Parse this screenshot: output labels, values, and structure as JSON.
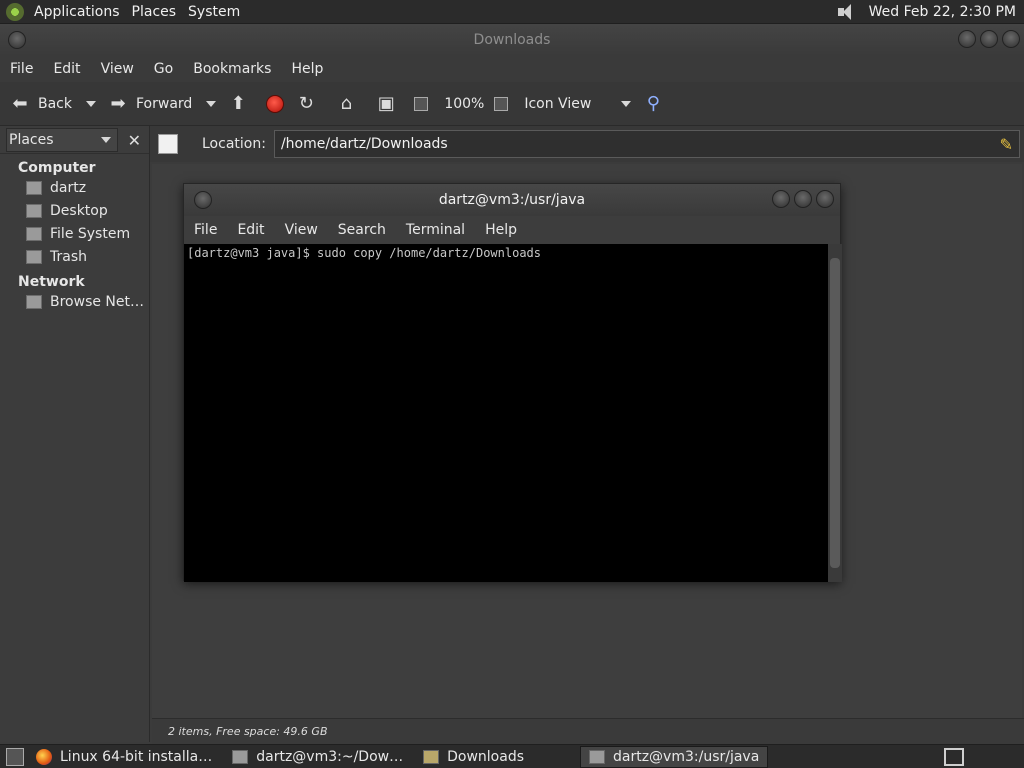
{
  "top_panel": {
    "menus": [
      "Applications",
      "Places",
      "System"
    ],
    "clock": "Wed Feb 22, 2:30 PM"
  },
  "file_manager": {
    "title": "Downloads",
    "menus": [
      "File",
      "Edit",
      "View",
      "Go",
      "Bookmarks",
      "Help"
    ],
    "toolbar": {
      "back": "Back",
      "forward": "Forward",
      "zoom": "100%",
      "view_mode": "Icon View"
    },
    "side_pane": {
      "selector": "Places",
      "sections": [
        {
          "title": "Computer",
          "items": [
            "dartz",
            "Desktop",
            "File System",
            "Trash"
          ]
        },
        {
          "title": "Network",
          "items": [
            "Browse Net…"
          ]
        }
      ]
    },
    "location": {
      "label": "Location:",
      "value": "/home/dartz/Downloads"
    },
    "status": "2 items, Free space: 49.6 GB"
  },
  "terminal": {
    "title": "dartz@vm3:/usr/java",
    "menus": [
      "File",
      "Edit",
      "View",
      "Search",
      "Terminal",
      "Help"
    ],
    "output": "[dartz@vm3 java]$ sudo copy /home/dartz/Downloads"
  },
  "taskbar": {
    "tasks": [
      {
        "label": "Linux 64-bit installa…",
        "icon": "firefox-icon"
      },
      {
        "label": "dartz@vm3:~/Dow…",
        "icon": "terminal-icon"
      },
      {
        "label": "Downloads",
        "icon": "folder-icon"
      },
      {
        "label": "dartz@vm3:/usr/java",
        "icon": "terminal-icon"
      }
    ]
  }
}
